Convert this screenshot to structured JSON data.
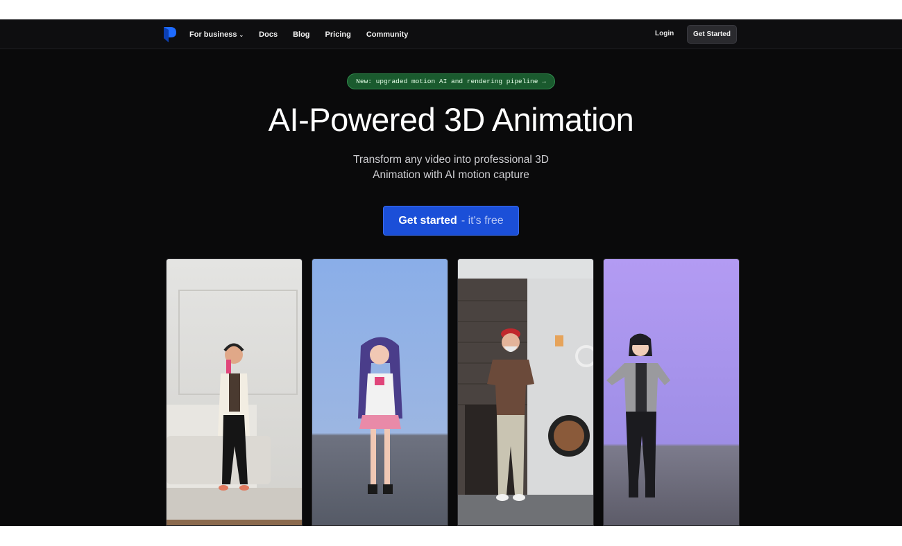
{
  "nav": {
    "logo": "logo-icon",
    "links": [
      "For business",
      "Docs",
      "Blog",
      "Pricing",
      "Community"
    ],
    "login_label": "Login",
    "get_started_label": "Get Started"
  },
  "hero": {
    "badge": "New: upgraded motion AI and rendering pipeline →",
    "title": "AI-Powered 3D Animation",
    "subtitle_line1": "Transform any video into professional 3D",
    "subtitle_line2": "Animation with AI motion capture",
    "cta_main": "Get started",
    "cta_sub": "- it's free"
  },
  "colors": {
    "background": "#0a0a0b",
    "badge_bg": "#1a5a2e",
    "cta": "#1b4fd8"
  },
  "cards": [
    "real-dancer-video",
    "anime-avatar-render",
    "real-man-video",
    "anime-avatar-render-purple"
  ]
}
